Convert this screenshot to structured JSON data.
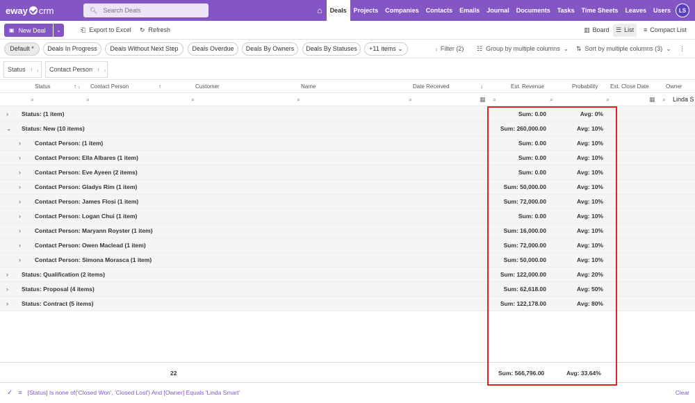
{
  "app": {
    "logo_main": "eway",
    "logo_sub": "crm",
    "search_placeholder": "Search Deals",
    "user_initials": "LS"
  },
  "nav": [
    "Deals",
    "Projects",
    "Companies",
    "Contacts",
    "Emails",
    "Journal",
    "Documents",
    "Tasks",
    "Time Sheets",
    "Leaves",
    "Users"
  ],
  "toolbar": {
    "new_deal": "New Deal",
    "export": "Export to Excel",
    "refresh": "Refresh",
    "board": "Board",
    "list": "List",
    "compact_list": "Compact List"
  },
  "views": {
    "default": "Default *",
    "in_progress": "Deals In Progress",
    "without_next_step": "Deals Without Next Step",
    "overdue": "Deals Overdue",
    "by_owners": "Deals By Owners",
    "by_statuses": "Deals By Statuses",
    "more": "+11 items"
  },
  "tools": {
    "filter": "Filter (2)",
    "group_by": "Group by multiple columns",
    "sort_by": "Sort by multiple columns (3)"
  },
  "grouping": {
    "status": "Status",
    "contact_person": "Contact Person"
  },
  "columns": {
    "status": "Status",
    "contact_person": "Contact Person",
    "customer": "Customer",
    "name": "Name",
    "date_received": "Date Received",
    "est_revenue": "Est. Revenue",
    "probability": "Probability",
    "est_close_date": "Est. Close Date",
    "owner": "Owner",
    "owner_filter": "Linda S"
  },
  "groups": [
    {
      "level": 0,
      "expanded": false,
      "label": "Status: (1 item)",
      "sum": "Sum: 0.00",
      "avg": "Avg: 0%"
    },
    {
      "level": 0,
      "expanded": true,
      "label": "Status: New (10 items)",
      "sum": "Sum: 260,000.00",
      "avg": "Avg: 10%"
    },
    {
      "level": 1,
      "expanded": false,
      "label": "Contact Person: (1 item)",
      "sum": "Sum: 0.00",
      "avg": "Avg: 10%"
    },
    {
      "level": 1,
      "expanded": false,
      "label": "Contact Person: Ella Albares (1 item)",
      "sum": "Sum: 0.00",
      "avg": "Avg: 10%"
    },
    {
      "level": 1,
      "expanded": false,
      "label": "Contact Person: Eve Ayeen (2 items)",
      "sum": "Sum: 0.00",
      "avg": "Avg: 10%"
    },
    {
      "level": 1,
      "expanded": false,
      "label": "Contact Person: Gladys Rim (1 item)",
      "sum": "Sum: 50,000.00",
      "avg": "Avg: 10%"
    },
    {
      "level": 1,
      "expanded": false,
      "label": "Contact Person: James Flosi (1 item)",
      "sum": "Sum: 72,000.00",
      "avg": "Avg: 10%"
    },
    {
      "level": 1,
      "expanded": false,
      "label": "Contact Person: Logan Chui (1 item)",
      "sum": "Sum: 0.00",
      "avg": "Avg: 10%"
    },
    {
      "level": 1,
      "expanded": false,
      "label": "Contact Person: Maryann Royster (1 item)",
      "sum": "Sum: 16,000.00",
      "avg": "Avg: 10%"
    },
    {
      "level": 1,
      "expanded": false,
      "label": "Contact Person: Owen Maclead (1 item)",
      "sum": "Sum: 72,000.00",
      "avg": "Avg: 10%"
    },
    {
      "level": 1,
      "expanded": false,
      "label": "Contact Person: Simona Morasca (1 item)",
      "sum": "Sum: 50,000.00",
      "avg": "Avg: 10%"
    },
    {
      "level": 0,
      "expanded": false,
      "label": "Status: Qualification (2 items)",
      "sum": "Sum: 122,000.00",
      "avg": "Avg: 20%"
    },
    {
      "level": 0,
      "expanded": false,
      "label": "Status: Proposal (4 items)",
      "sum": "Sum: 62,618.00",
      "avg": "Avg: 50%"
    },
    {
      "level": 0,
      "expanded": false,
      "label": "Status: Contract (5 items)",
      "sum": "Sum: 122,178.00",
      "avg": "Avg: 80%"
    }
  ],
  "footer": {
    "count": "22",
    "sum": "Sum: 566,796.00",
    "avg": "Avg: 33.64%"
  },
  "filter_bar": {
    "expression": "[Status] Is none of('Closed Won', 'Closed Lost') And [Owner] Equals 'Linda Smart'",
    "clear": "Clear"
  },
  "colors": {
    "brand": "#8456c4",
    "highlight": "#e02424"
  }
}
